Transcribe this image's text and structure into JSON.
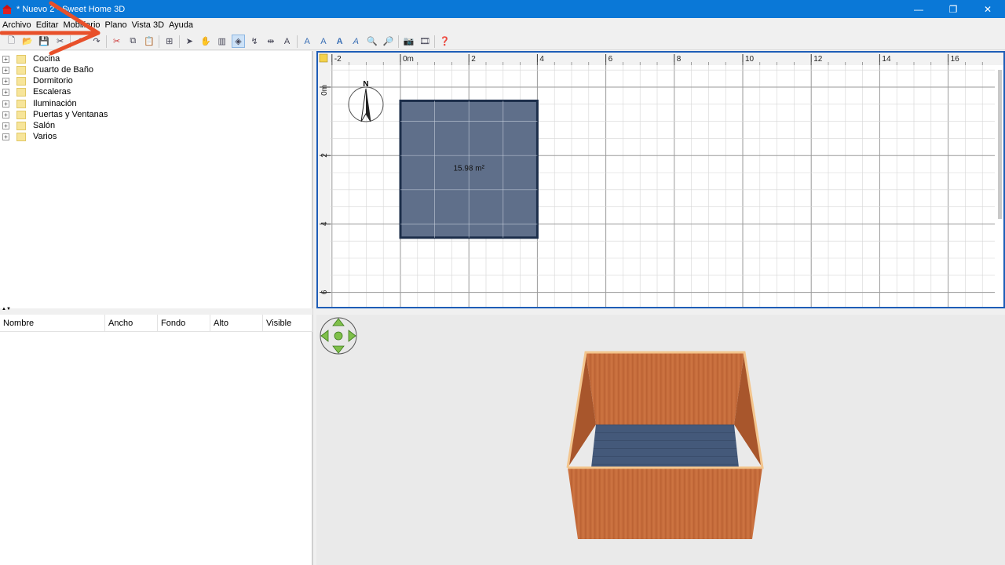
{
  "window": {
    "title": "* Nuevo 2 - Sweet Home 3D",
    "controls": {
      "minimize": "—",
      "maximize": "❐",
      "close": "✕"
    }
  },
  "menu": [
    "Archivo",
    "Editar",
    "Mobiliario",
    "Plano",
    "Vista 3D",
    "Ayuda"
  ],
  "toolbar": {
    "icons": [
      "new-icon",
      "open-icon",
      "save-icon",
      "cut-like-icon",
      "undo-icon",
      "redo-icon",
      "cut-icon",
      "copy-icon",
      "paste-icon",
      "add-furniture-icon",
      "select-icon",
      "pan-icon",
      "create-walls-icon",
      "create-rooms-icon",
      "create-polylines-icon",
      "create-dimensions-icon",
      "add-text-icon",
      "increase-text-icon",
      "decrease-text-icon",
      "bold-text-icon",
      "italic-text-icon",
      "zoom-in-icon",
      "zoom-out-icon",
      "photo-icon",
      "video-icon",
      "help-icon"
    ],
    "active": "create-rooms-icon"
  },
  "catalog": {
    "categories": [
      "Cocina",
      "Cuarto de Baño",
      "Dormitorio",
      "Escaleras",
      "Iluminación",
      "Puertas y Ventanas",
      "Salón",
      "Varios"
    ]
  },
  "furniture_table": {
    "columns": [
      "Nombre",
      "Ancho",
      "Fondo",
      "Alto",
      "Visible"
    ]
  },
  "chart_data": {
    "type": "table",
    "plan": {
      "x_ruler_labels": [
        "-2",
        "0m",
        "2",
        "4",
        "6",
        "8",
        "10",
        "12",
        "14",
        "16"
      ],
      "y_ruler_labels": [
        "0m",
        "2",
        "4",
        "6"
      ],
      "room": {
        "area_label": "15.98 m²",
        "x_range_m": [
          0,
          4
        ],
        "y_range_m": [
          0.4,
          4.4
        ]
      },
      "compass_label": "N"
    }
  },
  "colors": {
    "title_bar": "#0a78d7",
    "plan_border": "#1e5db7",
    "room_fill": "#5f6f8a",
    "wall_wood": "#c86f3d",
    "floor_blue": "#44597a",
    "annotation_arrow": "#e8502a"
  }
}
